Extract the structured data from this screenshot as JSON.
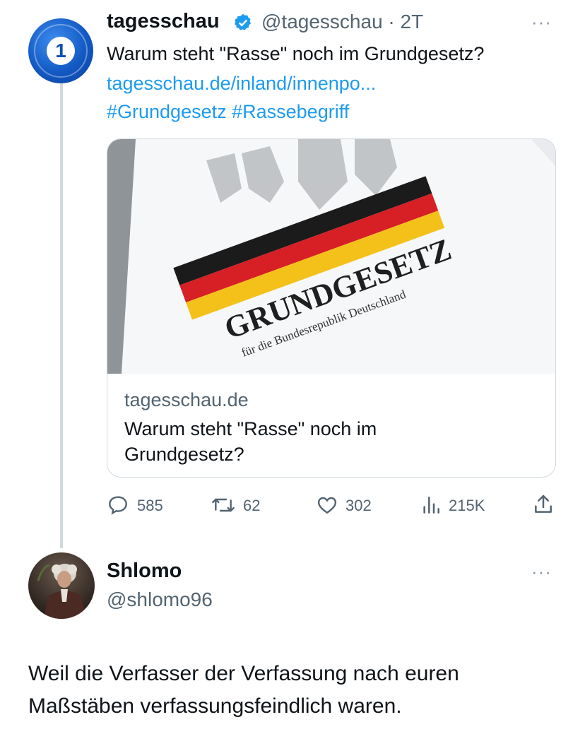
{
  "tweet": {
    "author_name": "tagesschau",
    "author_handle": "@tagesschau",
    "separator": "·",
    "time": "2T",
    "text": "Warum steht \"Rasse\" noch im Grundgesetz?",
    "link": "tagesschau.de/inland/innenpo...",
    "hashtags": "#Grundgesetz #Rassebegriff",
    "card": {
      "domain": "tagesschau.de",
      "title_line1": "Warum steht \"Rasse\" noch im",
      "title_line2": "Grundgesetz?",
      "image_text_main": "GRUNDGESETZ",
      "image_text_sub": "für die Bundesrepublik Deutschland"
    },
    "stats": {
      "replies": "585",
      "retweets": "62",
      "likes": "302",
      "views": "215K"
    }
  },
  "reply": {
    "author_name": "Shlomo",
    "author_handle": "@shlomo96",
    "text_line1": "Weil die Verfasser der Verfassung nach euren",
    "text_line2": "Maßstäben verfassungsfeindlich waren."
  },
  "more_glyph": "···",
  "colors": {
    "link": "#1d9bf0",
    "muted": "#536471",
    "border": "#cfd9de"
  },
  "icons": [
    "reply-icon",
    "retweet-icon",
    "like-icon",
    "views-icon",
    "share-icon",
    "verified-icon",
    "more-icon"
  ]
}
